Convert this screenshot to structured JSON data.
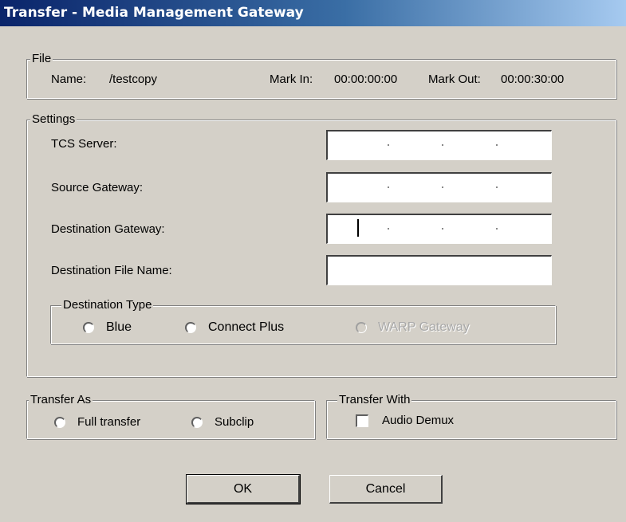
{
  "window": {
    "title": "Transfer - Media Management Gateway"
  },
  "file": {
    "legend": "File",
    "name_label": "Name:",
    "name_value": "/testcopy",
    "mark_in_label": "Mark In:",
    "mark_in_value": "00:00:00:00",
    "mark_out_label": "Mark Out:",
    "mark_out_value": "00:00:30:00"
  },
  "settings": {
    "legend": "Settings",
    "tcs_server_label": "TCS Server:",
    "source_gateway_label": "Source Gateway:",
    "destination_gateway_label": "Destination Gateway:",
    "destination_file_name_label": "Destination File Name:",
    "destination_file_name_value": "",
    "destination_type": {
      "legend": "Destination Type",
      "options": [
        "Blue",
        "Connect Plus",
        "WARP Gateway"
      ]
    }
  },
  "transfer_as": {
    "legend": "Transfer As",
    "options": [
      "Full transfer",
      "Subclip"
    ]
  },
  "transfer_with": {
    "legend": "Transfer With",
    "audio_demux_label": "Audio Demux"
  },
  "buttons": {
    "ok": "OK",
    "cancel": "Cancel"
  },
  "colors": {
    "dialog_bg": "#d4d0c8",
    "title_start": "#0a246a",
    "title_end": "#a6caf0"
  }
}
